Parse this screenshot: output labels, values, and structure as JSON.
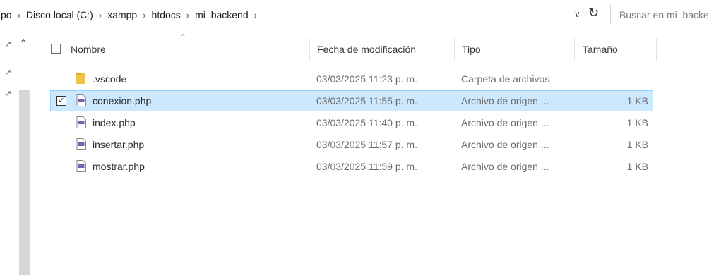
{
  "address_bar": {
    "breadcrumb": [
      "po",
      "Disco local (C:)",
      "xampp",
      "htdocs",
      "mi_backend"
    ],
    "search_placeholder": "Buscar en mi_backe"
  },
  "header": {
    "name": "Nombre",
    "date": "Fecha de modificación",
    "type": "Tipo",
    "size": "Tamaño"
  },
  "files": [
    {
      "name": ".vscode",
      "date": "03/03/2025 11:23 p. m.",
      "type": "Carpeta de archivos",
      "size": "",
      "kind": "folder",
      "selected": false
    },
    {
      "name": "conexion.php",
      "date": "03/03/2025 11:55 p. m.",
      "type": "Archivo de origen ...",
      "size": "1 KB",
      "kind": "php",
      "selected": true
    },
    {
      "name": "index.php",
      "date": "03/03/2025 11:40 p. m.",
      "type": "Archivo de origen ...",
      "size": "1 KB",
      "kind": "php",
      "selected": false
    },
    {
      "name": "insertar.php",
      "date": "03/03/2025 11:57 p. m.",
      "type": "Archivo de origen ...",
      "size": "1 KB",
      "kind": "php",
      "selected": false
    },
    {
      "name": "mostrar.php",
      "date": "03/03/2025 11:59 p. m.",
      "type": "Archivo de origen ...",
      "size": "1 KB",
      "kind": "php",
      "selected": false
    }
  ],
  "colors": {
    "selection_bg": "#cce8ff",
    "selection_border": "#99d1ff",
    "folder": "#f0c44c",
    "php_icon": "#7b5fb0"
  }
}
